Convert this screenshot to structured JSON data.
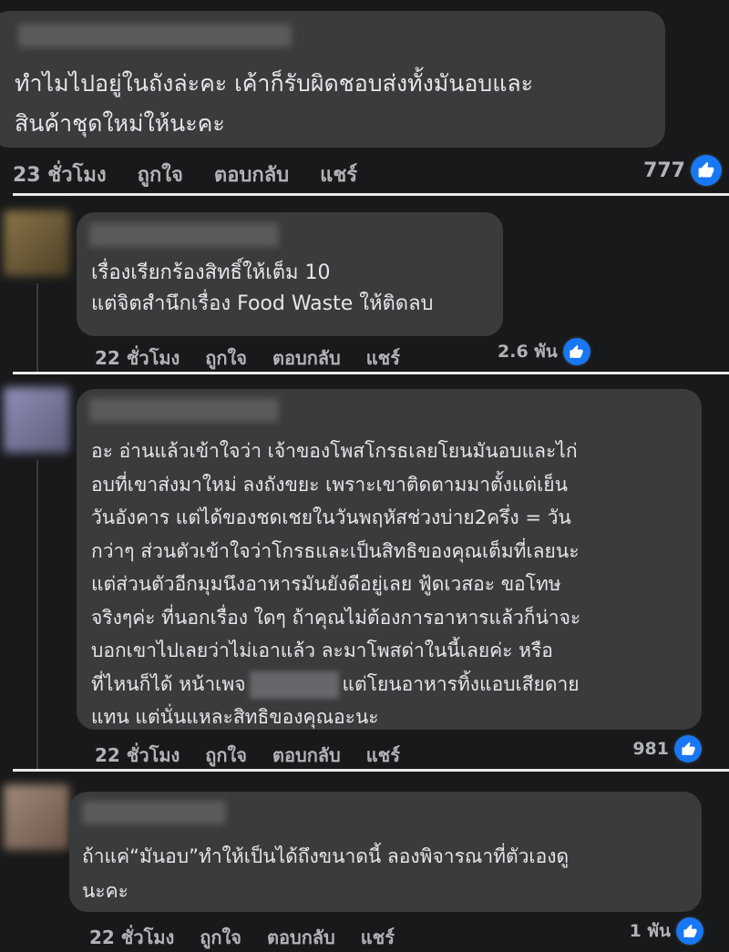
{
  "comments": [
    {
      "text": "ทำไมไปอยู่ในถังล่ะคะ เค้าก็รับผิดชอบส่งทั้งมันอบและ\nสินค้าชุดใหม่ให้นะคะ",
      "time": "23 ชั่วโมง",
      "like": "ถูกใจ",
      "reply": "ตอบกลับ",
      "share": "แชร์",
      "reactions": "777"
    },
    {
      "text": "เรื่องเรียกร้องสิทธิ์ให้เต็ม 10\nแต่จิตสำนึกเรื่อง Food Waste ให้ติดลบ",
      "time": "22 ชั่วโมง",
      "like": "ถูกใจ",
      "reply": "ตอบกลับ",
      "share": "แชร์",
      "reactions": "2.6 พัน"
    },
    {
      "text_before": "อะ อ่านแล้วเข้าใจว่า เจ้าของโพสโกรธเลยโยนมันอบและไก่\nอบที่เขาส่งมาใหม่ ลงถังขยะ เพราะเขาติดตามมาตั้งแต่เย็น\nวันอังคาร แต่ได้ของชดเชยในวันพฤหัสช่วงบ่าย2ครึ่ง = วัน\nกว่าๆ ส่วนตัวเข้าใจว่าโกรธและเป็นสิทธิของคุณเต็มที่เลยนะ\nแต่ส่วนตัวอีกมุมนึงอาหารมันยังดีอยู่เลย ฟู้ดเวสอะ ขอโทษ\nจริงๆค่ะ ที่นอกเรื่อง ใดๆ ถ้าคุณไม่ต้องการอาหารแล้วก็น่าจะ\nบอกเขาไปเลยว่าไม่เอาแล้ว ละมาโพสด่าในนี้เลยค่ะ หรือ\nที่ไหนก็ได้ หน้าเพจ",
      "text_after": "แต่โยนอาหารทิ้งแอบเสียดาย\nแทน แต่นั่นแหละสิทธิของคุณอะนะ",
      "time": "22 ชั่วโมง",
      "like": "ถูกใจ",
      "reply": "ตอบกลับ",
      "share": "แชร์",
      "reactions": "981"
    },
    {
      "text": "ถ้าแค่“มันอบ”ทำให้เป็นได้ถึงขนาดนี้ ลองพิจารณาที่ตัวเองดู\nนะคะ ￼",
      "time": "22 ชั่วโมง",
      "like": "ถูกใจ",
      "reply": "ตอบกลับ",
      "share": "แชร์",
      "reactions": "1 พัน"
    }
  ],
  "colors": {
    "background": "#18191a",
    "bubble": "#3a3b3c",
    "text": "#e4e6eb",
    "muted": "#b0b3b8",
    "like_blue": "#1877f2"
  },
  "icons": {
    "like": "thumbs-up-icon"
  }
}
